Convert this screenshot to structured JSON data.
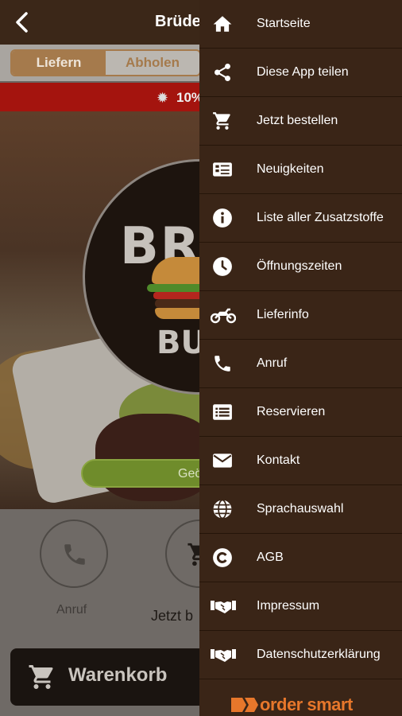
{
  "header": {
    "title": "Brüder",
    "back_icon": "chevron-left-icon"
  },
  "mode_tabs": [
    {
      "label": "Liefern",
      "selected": true
    },
    {
      "label": "Abholen",
      "selected": false
    }
  ],
  "promo": {
    "text": "10%",
    "icon": "badge-icon"
  },
  "logo": {
    "line1": "BRÜ",
    "line2": "BUR"
  },
  "status_button": {
    "label": "Geö"
  },
  "actions": [
    {
      "label": "Anruf",
      "icon": "phone-icon"
    },
    {
      "label": "Jetzt b",
      "icon": "cart-icon"
    }
  ],
  "cart_bar": {
    "label": "Warenkorb",
    "icon": "cart-icon"
  },
  "drawer": {
    "items": [
      {
        "label": "Startseite",
        "icon": "home-icon"
      },
      {
        "label": "Diese App teilen",
        "icon": "share-icon"
      },
      {
        "label": "Jetzt bestellen",
        "icon": "cart-icon"
      },
      {
        "label": "Neuigkeiten",
        "icon": "news-icon"
      },
      {
        "label": "Liste aller Zusatzstoffe",
        "icon": "info-icon"
      },
      {
        "label": "Öffnungszeiten",
        "icon": "clock-icon"
      },
      {
        "label": "Lieferinfo",
        "icon": "motorcycle-icon"
      },
      {
        "label": "Anruf",
        "icon": "phone-icon"
      },
      {
        "label": "Reservieren",
        "icon": "list-icon"
      },
      {
        "label": "Kontakt",
        "icon": "envelope-icon"
      },
      {
        "label": "Sprachauswahl",
        "icon": "globe-icon"
      },
      {
        "label": "AGB",
        "icon": "copyright-icon"
      },
      {
        "label": "Impressum",
        "icon": "handshake-icon"
      },
      {
        "label": "Datenschutzerklärung",
        "icon": "handshake-icon"
      }
    ],
    "brand": "order smart"
  },
  "colors": {
    "header_bg": "#3b2718",
    "drawer_bg": "#3a2517",
    "accent": "#a57a4c",
    "promo_red": "#a4140e",
    "open_green": "#6f8c2b",
    "brand_orange": "#e7772b"
  }
}
